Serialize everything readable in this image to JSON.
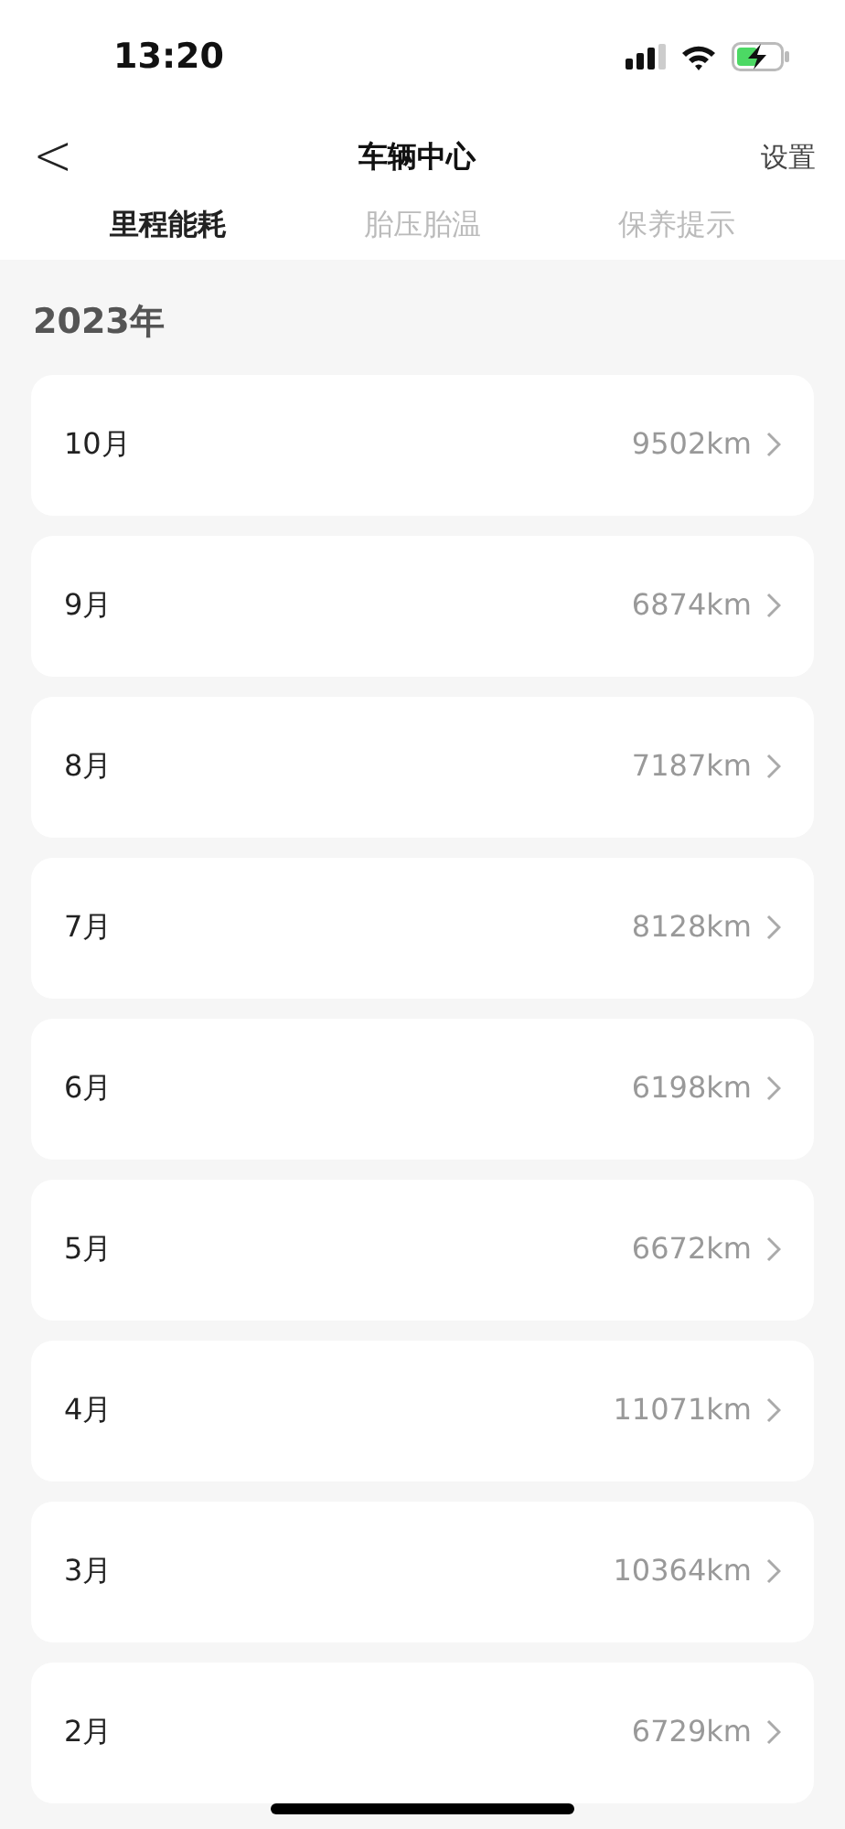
{
  "status_bar": {
    "time": "13:20"
  },
  "header": {
    "back": "<",
    "title": "车辆中心",
    "action": "设置"
  },
  "tabs": [
    {
      "label": "里程能耗",
      "selected": true
    },
    {
      "label": "胎压胎温",
      "selected": false
    },
    {
      "label": "保养提示",
      "selected": false
    }
  ],
  "year": "2023年",
  "months": [
    {
      "month": "10月",
      "distance": "9502km"
    },
    {
      "month": "9月",
      "distance": "6874km"
    },
    {
      "month": "8月",
      "distance": "7187km"
    },
    {
      "month": "7月",
      "distance": "8128km"
    },
    {
      "month": "6月",
      "distance": "6198km"
    },
    {
      "month": "5月",
      "distance": "6672km"
    },
    {
      "month": "4月",
      "distance": "11071km"
    },
    {
      "month": "3月",
      "distance": "10364km"
    },
    {
      "month": "2月",
      "distance": "6729km"
    }
  ]
}
